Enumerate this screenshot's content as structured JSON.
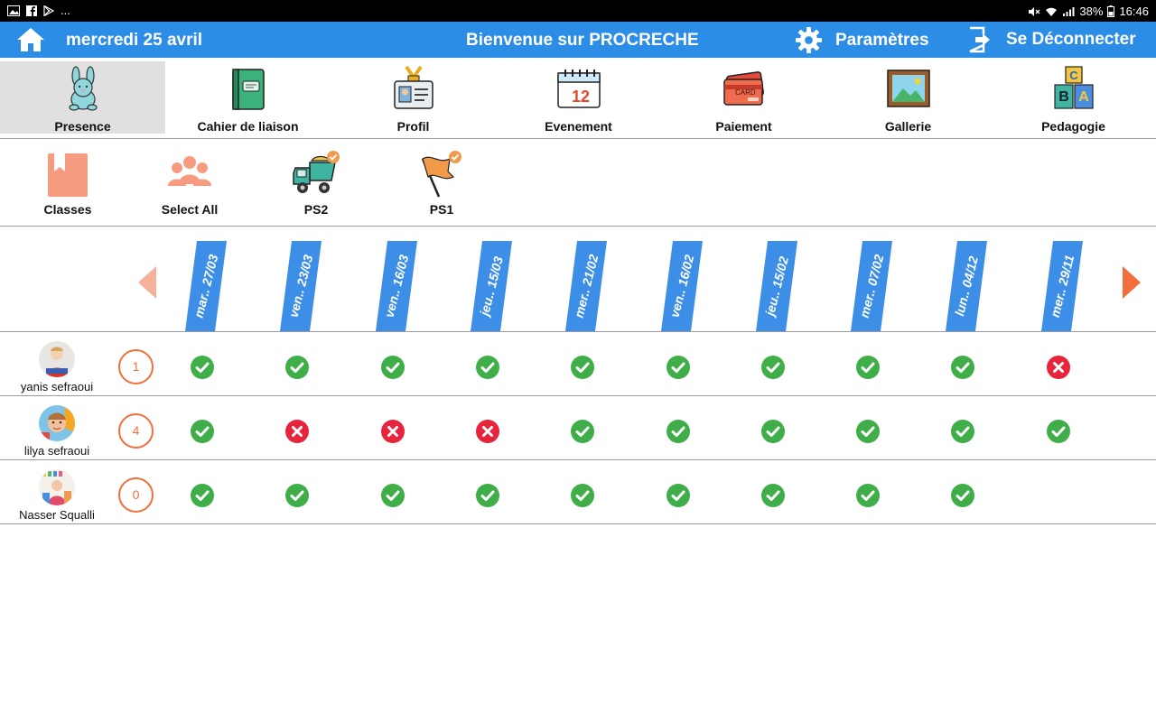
{
  "status_bar": {
    "more": "...",
    "battery": "38%",
    "time": "16:46"
  },
  "app_bar": {
    "date": "mercredi 25 avril",
    "title": "Bienvenue sur PROCRECHE",
    "settings_label": "Paramètres",
    "logout_label": "Se Déconnecter"
  },
  "main_nav": [
    {
      "label": "Presence",
      "icon": "bunny-icon",
      "active": true
    },
    {
      "label": "Cahier de liaison",
      "icon": "notebook-icon"
    },
    {
      "label": "Profil",
      "icon": "id-badge-icon"
    },
    {
      "label": "Evenement",
      "icon": "calendar-icon",
      "calendar_day": "12"
    },
    {
      "label": "Paiement",
      "icon": "credit-card-icon",
      "card_text": "CARD"
    },
    {
      "label": "Gallerie",
      "icon": "picture-icon"
    },
    {
      "label": "Pedagogie",
      "icon": "abc-blocks-icon",
      "block_letters": [
        "C",
        "B",
        "A"
      ]
    }
  ],
  "filters": [
    {
      "label": "Classes",
      "icon": "bookmark-icon"
    },
    {
      "label": "Select All",
      "icon": "group-icon"
    },
    {
      "label": "PS2",
      "icon": "truck-icon"
    },
    {
      "label": "PS1",
      "icon": "flag-icon"
    }
  ],
  "dates": [
    "mar.. 27/03",
    "ven.. 23/03",
    "ven.. 16/03",
    "jeu.. 15/03",
    "mer.. 21/02",
    "ven.. 16/02",
    "jeu.. 15/02",
    "mer.. 07/02",
    "lun.. 04/12",
    "mer.. 29/11"
  ],
  "children": [
    {
      "name": "yanis sefraoui",
      "count": "1",
      "attendance": [
        "present",
        "present",
        "present",
        "present",
        "present",
        "present",
        "present",
        "present",
        "present",
        "absent"
      ]
    },
    {
      "name": "lilya sefraoui",
      "count": "4",
      "attendance": [
        "present",
        "absent",
        "absent",
        "absent",
        "present",
        "present",
        "present",
        "present",
        "present",
        "present"
      ]
    },
    {
      "name": "Nasser Squalli",
      "count": "0",
      "attendance": [
        "present",
        "present",
        "present",
        "present",
        "present",
        "present",
        "present",
        "present",
        "present",
        null
      ]
    }
  ],
  "colors": {
    "app_bar": "#2c8de6",
    "date_tab": "#3c8ee6",
    "present": "#3fae49",
    "absent": "#e8243c",
    "count_ring": "#f26f3c",
    "arrow": "#f26f3c"
  }
}
